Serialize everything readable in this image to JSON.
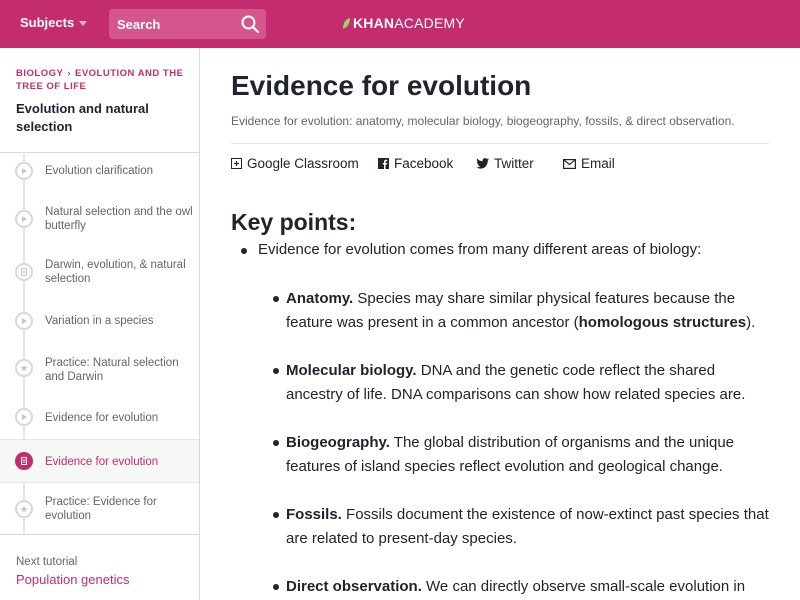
{
  "header": {
    "subjects_label": "Subjects",
    "search_placeholder": "Search",
    "logo_bold": "KHAN",
    "logo_light": "ACADEMY",
    "brand_color": "#c32c6e"
  },
  "sidebar": {
    "breadcrumb": [
      "BIOLOGY",
      "EVOLUTION AND THE TREE OF LIFE"
    ],
    "unit_title": "Evolution and natural selection",
    "items": [
      {
        "label": "Evolution clarification",
        "icon": "play-icon",
        "active": false
      },
      {
        "label": "Natural selection and the owl butterfly",
        "icon": "play-icon",
        "active": false
      },
      {
        "label": "Darwin, evolution, & natural selection",
        "icon": "article-icon",
        "active": false
      },
      {
        "label": "Variation in a species",
        "icon": "play-icon",
        "active": false
      },
      {
        "label": "Practice: Natural selection and Darwin",
        "icon": "star-icon",
        "active": false
      },
      {
        "label": "Evidence for evolution",
        "icon": "play-icon",
        "active": false
      },
      {
        "label": "Evidence for evolution",
        "icon": "article-icon",
        "active": true
      },
      {
        "label": "Practice: Evidence for evolution",
        "icon": "star-icon",
        "active": false
      }
    ],
    "next_label": "Next tutorial",
    "next_link": "Population genetics"
  },
  "main": {
    "title": "Evidence for evolution",
    "description": "Evidence for evolution: anatomy, molecular biology, biogeography, fossils, & direct observation.",
    "share": [
      {
        "label": "Google Classroom",
        "icon": "google-classroom-icon"
      },
      {
        "label": "Facebook",
        "icon": "facebook-icon"
      },
      {
        "label": "Twitter",
        "icon": "twitter-icon"
      },
      {
        "label": "Email",
        "icon": "email-icon"
      }
    ],
    "key_points_heading": "Key points:",
    "intro_bullet": "Evidence for evolution comes from many different areas of biology:",
    "points": [
      {
        "term": "Anatomy.",
        "line1": " Species may share similar physical features because the",
        "line2_pre": "feature was present in a common ancestor (",
        "line2_bold": "homologous structures",
        "line2_post": ")."
      },
      {
        "term": "Molecular biology.",
        "line1": " DNA and the genetic code reflect the shared",
        "line2": "ancestry of life. DNA comparisons can show how related species are."
      },
      {
        "term": "Biogeography.",
        "line1": " The global distribution of organisms and the unique",
        "line2": "features of island species reflect evolution and geological change."
      },
      {
        "term": "Fossils.",
        "line1": " Fossils document the existence of now-extinct past species that",
        "line2": "are related to present-day species."
      },
      {
        "term": "Direct observation.",
        "line1": " We can directly observe small-scale evolution in"
      }
    ]
  }
}
